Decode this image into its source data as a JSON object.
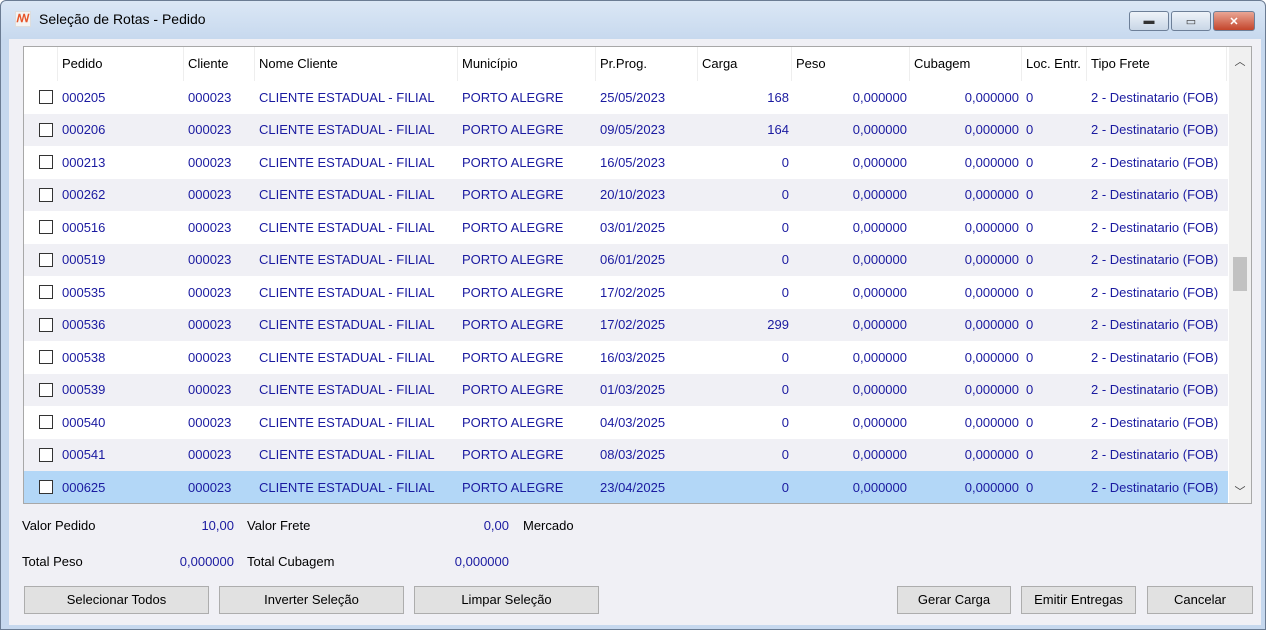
{
  "window": {
    "title": "Seleção de Rotas - Pedido",
    "icon": "app-logo-icon",
    "minimize": "minimize-icon",
    "maximize": "maximize-icon",
    "close": "close-icon"
  },
  "grid": {
    "columns": [
      "",
      "Pedido",
      "Cliente",
      "Nome Cliente",
      "Município",
      "Pr.Prog.",
      "Carga",
      "Peso",
      "Cubagem",
      "Loc. Entr.",
      "Tipo Frete"
    ],
    "rows": [
      [
        "000205",
        "000023",
        "CLIENTE ESTADUAL - FILIAL",
        "PORTO ALEGRE",
        "25/05/2023",
        "168",
        "0,000000",
        "0,000000",
        "0",
        "2 - Destinatario (FOB)"
      ],
      [
        "000206",
        "000023",
        "CLIENTE ESTADUAL - FILIAL",
        "PORTO ALEGRE",
        "09/05/2023",
        "164",
        "0,000000",
        "0,000000",
        "0",
        "2 - Destinatario (FOB)"
      ],
      [
        "000213",
        "000023",
        "CLIENTE ESTADUAL - FILIAL",
        "PORTO ALEGRE",
        "16/05/2023",
        "0",
        "0,000000",
        "0,000000",
        "0",
        "2 - Destinatario (FOB)"
      ],
      [
        "000262",
        "000023",
        "CLIENTE ESTADUAL - FILIAL",
        "PORTO ALEGRE",
        "20/10/2023",
        "0",
        "0,000000",
        "0,000000",
        "0",
        "2 - Destinatario (FOB)"
      ],
      [
        "000516",
        "000023",
        "CLIENTE ESTADUAL - FILIAL",
        "PORTO ALEGRE",
        "03/01/2025",
        "0",
        "0,000000",
        "0,000000",
        "0",
        "2 - Destinatario (FOB)"
      ],
      [
        "000519",
        "000023",
        "CLIENTE ESTADUAL - FILIAL",
        "PORTO ALEGRE",
        "06/01/2025",
        "0",
        "0,000000",
        "0,000000",
        "0",
        "2 - Destinatario (FOB)"
      ],
      [
        "000535",
        "000023",
        "CLIENTE ESTADUAL - FILIAL",
        "PORTO ALEGRE",
        "17/02/2025",
        "0",
        "0,000000",
        "0,000000",
        "0",
        "2 - Destinatario (FOB)"
      ],
      [
        "000536",
        "000023",
        "CLIENTE ESTADUAL - FILIAL",
        "PORTO ALEGRE",
        "17/02/2025",
        "299",
        "0,000000",
        "0,000000",
        "0",
        "2 - Destinatario (FOB)"
      ],
      [
        "000538",
        "000023",
        "CLIENTE ESTADUAL - FILIAL",
        "PORTO ALEGRE",
        "16/03/2025",
        "0",
        "0,000000",
        "0,000000",
        "0",
        "2 - Destinatario (FOB)"
      ],
      [
        "000539",
        "000023",
        "CLIENTE ESTADUAL - FILIAL",
        "PORTO ALEGRE",
        "01/03/2025",
        "0",
        "0,000000",
        "0,000000",
        "0",
        "2 - Destinatario (FOB)"
      ],
      [
        "000540",
        "000023",
        "CLIENTE ESTADUAL - FILIAL",
        "PORTO ALEGRE",
        "04/03/2025",
        "0",
        "0,000000",
        "0,000000",
        "0",
        "2 - Destinatario (FOB)"
      ],
      [
        "000541",
        "000023",
        "CLIENTE ESTADUAL - FILIAL",
        "PORTO ALEGRE",
        "08/03/2025",
        "0",
        "0,000000",
        "0,000000",
        "0",
        "2 - Destinatario (FOB)"
      ],
      [
        "000625",
        "000023",
        "CLIENTE ESTADUAL - FILIAL",
        "PORTO ALEGRE",
        "23/04/2025",
        "0",
        "0,000000",
        "0,000000",
        "0",
        "2 - Destinatario (FOB)"
      ]
    ],
    "selected_row": 12
  },
  "summary": {
    "valor_pedido_label": "Valor Pedido",
    "valor_pedido": "10,00",
    "valor_frete_label": "Valor Frete",
    "valor_frete": "0,00",
    "mercado_label": "Mercado",
    "total_peso_label": "Total Peso",
    "total_peso": "0,000000",
    "total_cubagem_label": "Total Cubagem",
    "total_cubagem": "0,000000"
  },
  "buttons": {
    "selecionar_todos": "Selecionar Todos",
    "inverter": "Inverter Seleção",
    "limpar": "Limpar Seleção",
    "gerar_carga": "Gerar Carga",
    "emitir_entregas": "Emitir Entregas",
    "cancelar": "Cancelar"
  }
}
